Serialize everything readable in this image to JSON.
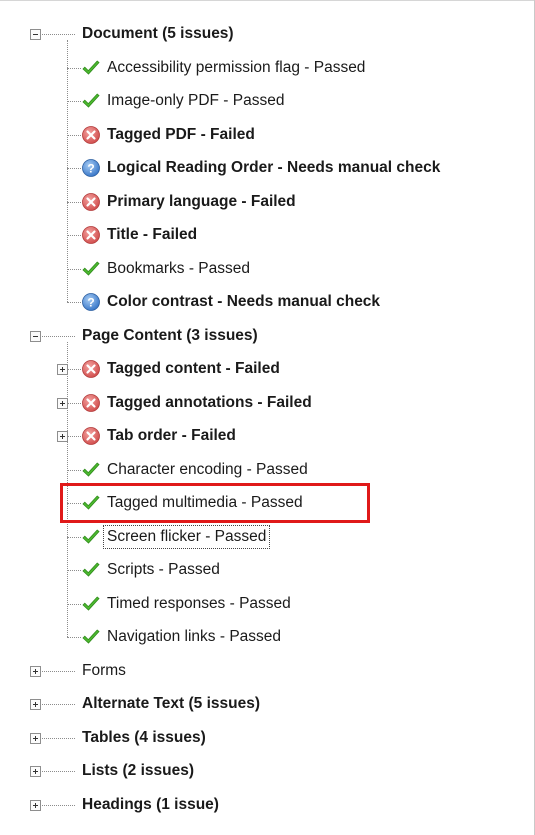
{
  "tree": [
    {
      "label": "Document (5 issues)",
      "bold": true,
      "expanded": true,
      "children": [
        {
          "label": "Accessibility permission flag - Passed",
          "status": "passed"
        },
        {
          "label": "Image-only PDF - Passed",
          "status": "passed"
        },
        {
          "label": "Tagged PDF - Failed",
          "status": "failed"
        },
        {
          "label": "Logical Reading Order - Needs manual check",
          "status": "manual"
        },
        {
          "label": "Primary language - Failed",
          "status": "failed"
        },
        {
          "label": "Title - Failed",
          "status": "failed"
        },
        {
          "label": "Bookmarks - Passed",
          "status": "passed"
        },
        {
          "label": "Color contrast - Needs manual check",
          "status": "manual"
        }
      ]
    },
    {
      "label": "Page Content (3 issues)",
      "bold": true,
      "expanded": true,
      "children": [
        {
          "label": "Tagged content - Failed",
          "status": "failed",
          "expandable": true
        },
        {
          "label": "Tagged annotations - Failed",
          "status": "failed",
          "expandable": true
        },
        {
          "label": "Tab order - Failed",
          "status": "failed",
          "expandable": true
        },
        {
          "label": "Character encoding - Passed",
          "status": "passed"
        },
        {
          "label": "Tagged multimedia - Passed",
          "status": "passed",
          "highlighted": true
        },
        {
          "label": "Screen flicker - Passed",
          "status": "passed",
          "focused": true
        },
        {
          "label": "Scripts - Passed",
          "status": "passed"
        },
        {
          "label": "Timed responses - Passed",
          "status": "passed"
        },
        {
          "label": "Navigation links - Passed",
          "status": "passed"
        }
      ]
    },
    {
      "label": "Forms",
      "bold": false,
      "expanded": false
    },
    {
      "label": "Alternate Text (5 issues)",
      "bold": true,
      "expanded": false
    },
    {
      "label": "Tables (4 issues)",
      "bold": true,
      "expanded": false
    },
    {
      "label": "Lists (2 issues)",
      "bold": true,
      "expanded": false
    },
    {
      "label": "Headings (1 issue)",
      "bold": true,
      "expanded": false
    }
  ],
  "icons": {
    "passed": "checkmark-icon",
    "failed": "error-x-icon",
    "manual": "question-icon"
  },
  "colors": {
    "passed": "#4cb82f",
    "failed": "#d2504f",
    "manual": "#3a78c9",
    "highlight": "#e01919"
  }
}
